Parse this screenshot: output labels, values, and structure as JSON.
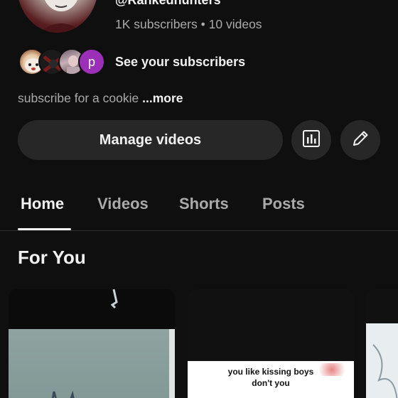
{
  "channel": {
    "handle": "@Rankedhunters",
    "subscribers": "1K subscribers",
    "separator": "•",
    "videos": "10 videos",
    "see_subscribers": "See your subscribers",
    "subscriber_avatar_letter": "p",
    "description": "subscribe for a cookie",
    "more_label": "...more"
  },
  "actions": {
    "manage_label": "Manage videos",
    "analytics_icon": "analytics-icon",
    "edit_icon": "pencil-icon"
  },
  "tabs": [
    {
      "label": "Home",
      "active": true
    },
    {
      "label": "Videos",
      "active": false
    },
    {
      "label": "Shorts",
      "active": false
    },
    {
      "label": "Posts",
      "active": false
    }
  ],
  "section": {
    "title": "For You"
  },
  "cards": [
    {
      "caption": ""
    },
    {
      "caption_line1": "you like kissing boys",
      "caption_line2": "don't you"
    },
    {
      "caption": ""
    }
  ],
  "colors": {
    "background": "#0f0f0f",
    "button": "#272727",
    "text_primary": "#f1f1f1",
    "text_secondary": "#aaaaaa",
    "avatar_purple": "#9c2fb8"
  }
}
